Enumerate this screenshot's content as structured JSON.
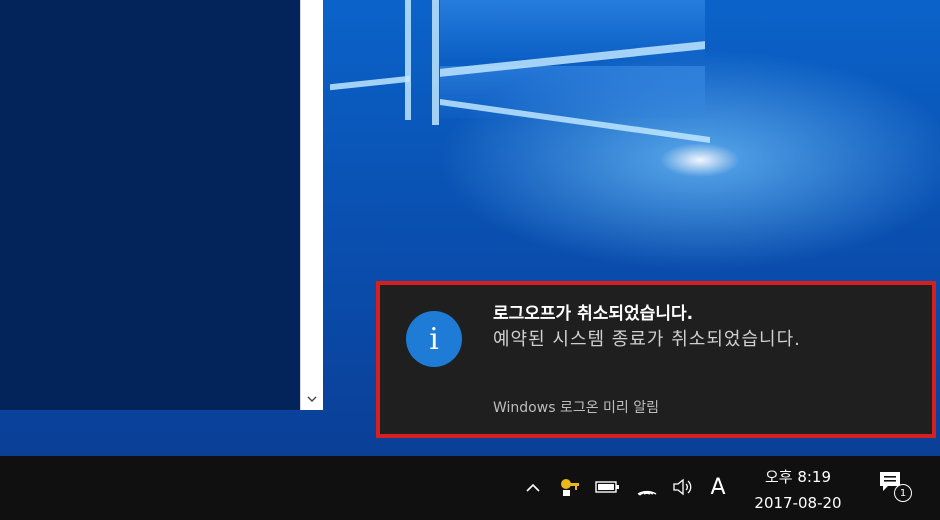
{
  "toast": {
    "title": "로그오프가 취소되었습니다.",
    "body": "예약된 시스템 종료가 취소되었습니다.",
    "source": "Windows 로그온 미리 알림",
    "icon": "info-icon",
    "icon_glyph": "i",
    "highlight_color": "#d61f1f"
  },
  "taskbar": {
    "ime_label": "A",
    "clock": {
      "time": "오후 8:19",
      "date": "2017-08-20"
    },
    "notifications_count": "1"
  },
  "icons": {
    "tray_up": "chevron-up-icon",
    "security": "security-key-icon",
    "battery": "battery-icon",
    "wifi": "wifi-icon",
    "volume": "volume-icon",
    "action_center": "action-center-icon",
    "scroll_down": "chevron-down-icon"
  }
}
